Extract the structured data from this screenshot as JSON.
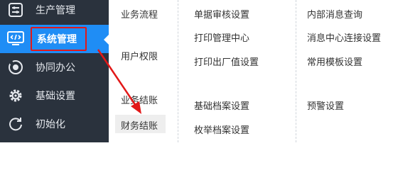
{
  "sidebar": {
    "items": [
      {
        "label": "生产管理",
        "icon": "production-icon"
      },
      {
        "label": "系统管理",
        "icon": "monitor-code-icon"
      },
      {
        "label": "协同办公",
        "icon": "collaboration-icon"
      },
      {
        "label": "基础设置",
        "icon": "gear-icon"
      },
      {
        "label": "初始化",
        "icon": "refresh-icon"
      }
    ]
  },
  "menu": {
    "col1": [
      "业务流程",
      "用户权限",
      "业务结账",
      "财务结账"
    ],
    "col2": [
      "单据审核设置",
      "打印管理中心",
      "打印出厂值设置",
      "基础档案设置",
      "枚举档案设置"
    ],
    "col3": [
      "内部消息查询",
      "消息中心连接设置",
      "常用模板设置",
      "预警设置"
    ]
  },
  "colors": {
    "sidebar_bg": "#2a323d",
    "active_bg": "#1f8df5",
    "annotation_red": "#e21818"
  }
}
